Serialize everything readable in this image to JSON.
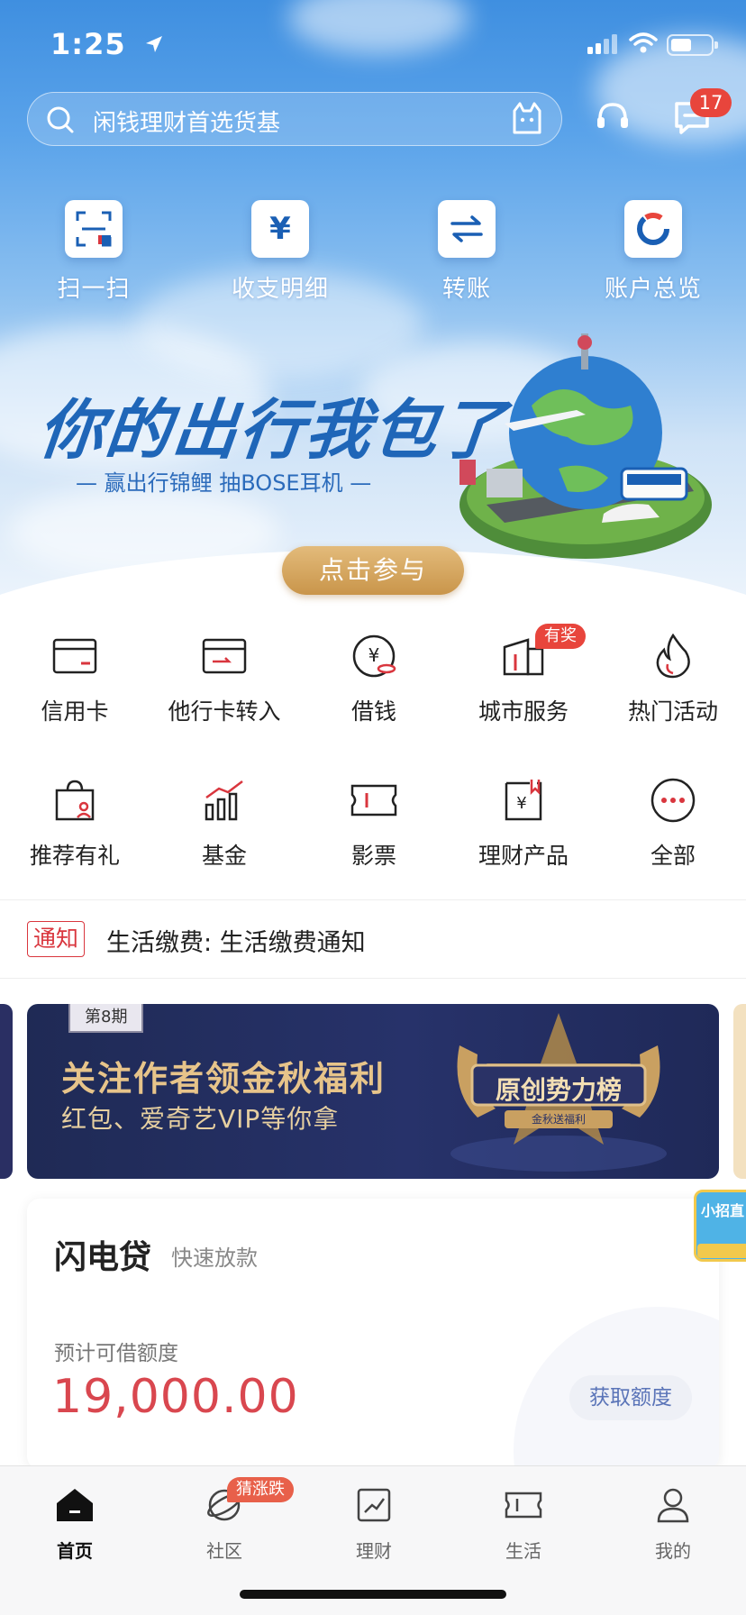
{
  "status_bar": {
    "time": "1:25"
  },
  "search": {
    "placeholder": "闲钱理财首选货基"
  },
  "header": {
    "message_count": "17"
  },
  "quick_actions": [
    {
      "label": "扫一扫",
      "icon": "scan-icon"
    },
    {
      "label": "收支明细",
      "icon": "yuan-icon"
    },
    {
      "label": "转账",
      "icon": "transfer-icon"
    },
    {
      "label": "账户总览",
      "icon": "overview-ring-icon"
    }
  ],
  "banner": {
    "title": "你的出行我包了",
    "subtitle": "— 赢出行锦鲤 抽BOSE耳机 —",
    "cta": "点击参与"
  },
  "services": [
    {
      "label": "信用卡",
      "icon": "credit-card-icon"
    },
    {
      "label": "他行卡转入",
      "icon": "card-transfer-icon"
    },
    {
      "label": "借钱",
      "icon": "borrow-icon"
    },
    {
      "label": "城市服务",
      "icon": "city-service-icon",
      "badge": "有奖"
    },
    {
      "label": "热门活动",
      "icon": "flame-icon"
    },
    {
      "label": "推荐有礼",
      "icon": "gift-bag-icon"
    },
    {
      "label": "基金",
      "icon": "fund-chart-icon"
    },
    {
      "label": "影票",
      "icon": "ticket-icon"
    },
    {
      "label": "理财产品",
      "icon": "wealth-product-icon"
    },
    {
      "label": "全部",
      "icon": "more-icon"
    }
  ],
  "notice": {
    "tag": "通知",
    "text": "生活缴费: 生活缴费通知"
  },
  "promo": {
    "issue": "第8期",
    "title": "关注作者领金秋福利",
    "subtitle": "红包、爱奇艺VIP等你拿",
    "medal_title": "原创势力榜",
    "medal_sub": "金秋送福利"
  },
  "loan": {
    "title": "闪电贷",
    "subtitle": "快速放款",
    "amount_label": "预计可借额度",
    "amount": "19,000.00",
    "button": "获取额度"
  },
  "floating_widget": {
    "label": "小招直"
  },
  "tabbar": [
    {
      "label": "首页",
      "icon": "home-icon",
      "active": true
    },
    {
      "label": "社区",
      "icon": "community-icon",
      "badge": "猜涨跌"
    },
    {
      "label": "理财",
      "icon": "wealth-icon"
    },
    {
      "label": "生活",
      "icon": "life-ticket-icon"
    },
    {
      "label": "我的",
      "icon": "profile-icon"
    }
  ],
  "colors": {
    "primary_blue": "#3f8fe0",
    "accent_red": "#d9474f",
    "gold": "#c9954a"
  }
}
